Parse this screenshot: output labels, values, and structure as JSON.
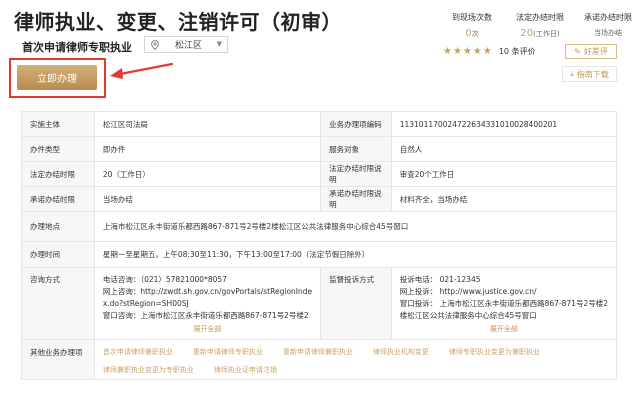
{
  "header": {
    "title": "律师执业、变更、注销许可（初审）",
    "subtitle": "首次申请律师专职执业",
    "region": "松江区"
  },
  "stats": [
    {
      "label": "到现场次数",
      "value": "0",
      "unit": "次"
    },
    {
      "label": "法定办结时限",
      "value": "20",
      "unit": "(工作日)"
    },
    {
      "label": "承诺办结时限",
      "value": "当场办结",
      "unit": ""
    }
  ],
  "rating": {
    "stars": 5,
    "count_text": "10 条评价"
  },
  "buttons": {
    "bad_review": "好差评",
    "guide_download": "指南下载",
    "apply": "立即办理"
  },
  "colors": {
    "accent": "#c29a56",
    "highlight": "#e23b2e"
  },
  "table": {
    "rows": [
      {
        "k1": "实施主体",
        "v1": "松江区司法局",
        "k2": "业务办理项编码",
        "v2": "11310117002472263433101002840020​1"
      },
      {
        "k1": "办件类型",
        "v1": "即办件",
        "k2": "服务对象",
        "v2": "自然人"
      },
      {
        "k1": "法定办结时限",
        "v1": "20（工作日）",
        "k2": "法定办结时限说明",
        "v2": "审查20个工作日"
      },
      {
        "k1": "承诺办结时限",
        "v1": "当场办结",
        "k2": "承诺办结时限说明",
        "v2": "材料齐全，当场办结"
      }
    ],
    "address": {
      "label": "办理地点",
      "value": "上海市松江区永丰街道乐都西路867-871号2号楼2楼松江区公共法律服务中心综合45号窗口"
    },
    "hours": {
      "label": "办理时间",
      "value": "星期一至星期五，上午08:30至11:30，下午13:00至17:00（法定节假日除外）"
    },
    "consult": {
      "label": "咨询方式",
      "lines": [
        "电话咨询：（021）57821000*8057",
        "网上咨询：http://zwdt.sh.gov.cn/govPortals/stRegionInde",
        "x.do?stRegion=SH00SJ",
        "窗口咨询：上海市松江区永丰街道乐都西路867-871号2号楼2"
      ],
      "expand": "展开全部"
    },
    "complain": {
      "label": "监督投诉方式",
      "lines": [
        "投诉电话：  021-12345",
        "网上投诉：  http://www.justice.gov.cn/",
        "窗口投诉：  上海市松江区永丰街道乐都西路867-871号2号楼2",
        "楼松江区公共法律服务中心综合45号窗口"
      ],
      "expand": "展开全部"
    },
    "other": {
      "label": "其他业务办理项",
      "links": [
        "首次申请律师兼职执业",
        "重新申请律师专职执业",
        "重新申请律师兼职执业",
        "律师执业机构变更",
        "律师专职执业变更为兼职执业",
        "律师兼职执业变更为专职执业",
        "律师执业证申请注销"
      ]
    }
  }
}
